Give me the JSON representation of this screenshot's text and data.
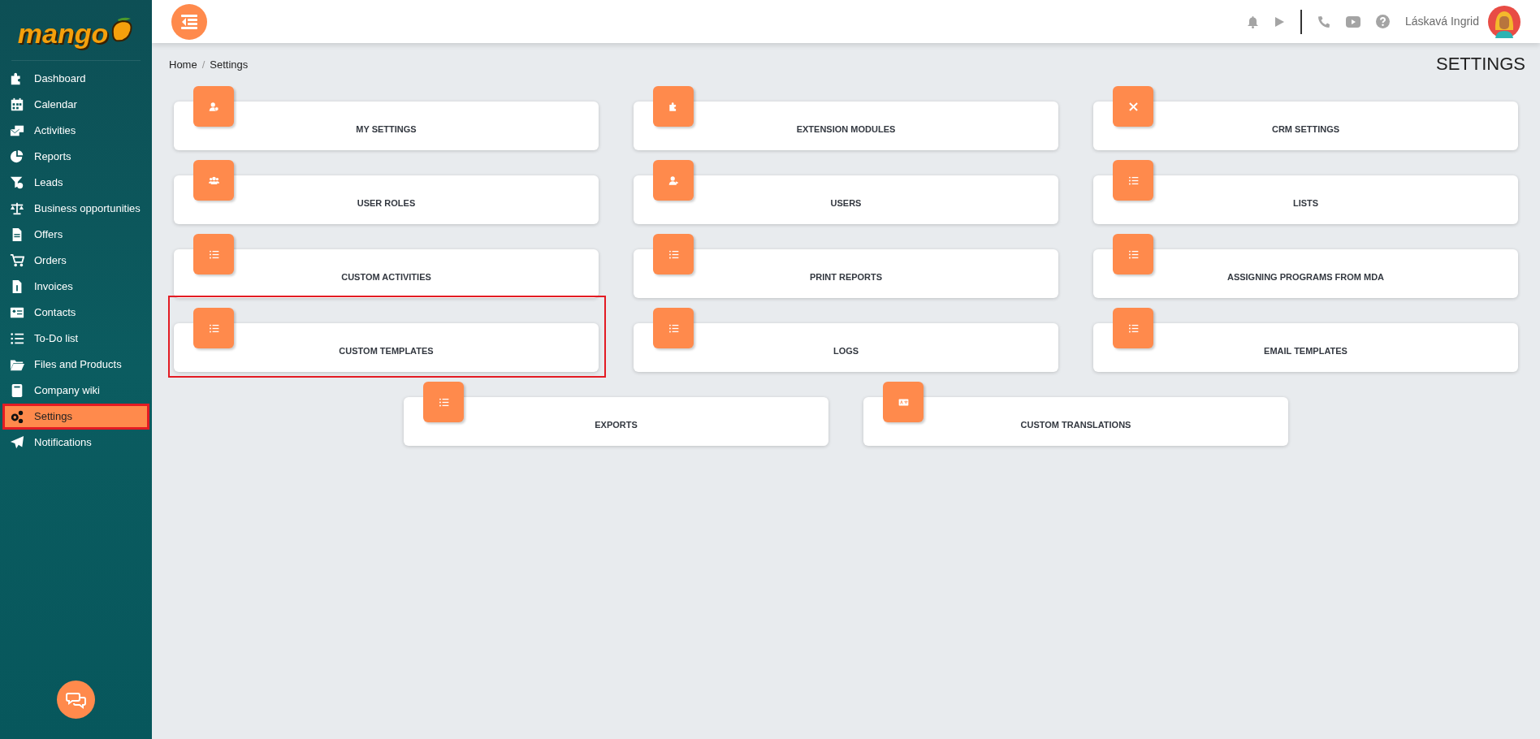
{
  "logo": {
    "text": "mango"
  },
  "sidebar": {
    "items": [
      {
        "label": "Dashboard",
        "selected": false,
        "highlighted": false
      },
      {
        "label": "Calendar",
        "selected": false,
        "highlighted": false
      },
      {
        "label": "Activities",
        "selected": false,
        "highlighted": false
      },
      {
        "label": "Reports",
        "selected": false,
        "highlighted": false
      },
      {
        "label": "Leads",
        "selected": false,
        "highlighted": false
      },
      {
        "label": "Business opportunities",
        "selected": false,
        "highlighted": false
      },
      {
        "label": "Offers",
        "selected": false,
        "highlighted": false
      },
      {
        "label": "Orders",
        "selected": false,
        "highlighted": false
      },
      {
        "label": "Invoices",
        "selected": false,
        "highlighted": false
      },
      {
        "label": "Contacts",
        "selected": false,
        "highlighted": false
      },
      {
        "label": "To-Do list",
        "selected": false,
        "highlighted": false
      },
      {
        "label": "Files and Products",
        "selected": false,
        "highlighted": false
      },
      {
        "label": "Company wiki",
        "selected": false,
        "highlighted": false
      },
      {
        "label": "Settings",
        "selected": true,
        "highlighted": true
      },
      {
        "label": "Notifications",
        "selected": false,
        "highlighted": false
      }
    ]
  },
  "topbar": {
    "user_name": "Láskavá Ingrid"
  },
  "breadcrumb": {
    "items": [
      "Home",
      "Settings"
    ],
    "separator": "/"
  },
  "page_title": "SETTINGS",
  "cards": [
    {
      "label": "MY SETTINGS",
      "highlighted": false
    },
    {
      "label": "EXTENSION MODULES",
      "highlighted": false
    },
    {
      "label": "CRM SETTINGS",
      "highlighted": false
    },
    {
      "label": "USER ROLES",
      "highlighted": false
    },
    {
      "label": "USERS",
      "highlighted": false
    },
    {
      "label": "LISTS",
      "highlighted": false
    },
    {
      "label": "CUSTOM ACTIVITIES",
      "highlighted": false
    },
    {
      "label": "PRINT REPORTS",
      "highlighted": false
    },
    {
      "label": "ASSIGNING PROGRAMS FROM MDA",
      "highlighted": false
    },
    {
      "label": "CUSTOM TEMPLATES",
      "highlighted": true
    },
    {
      "label": "LOGS",
      "highlighted": false
    },
    {
      "label": "EMAIL TEMPLATES",
      "highlighted": false
    },
    {
      "label": "EXPORTS",
      "highlighted": false
    },
    {
      "label": "CUSTOM TRANSLATIONS",
      "highlighted": false
    }
  ]
}
